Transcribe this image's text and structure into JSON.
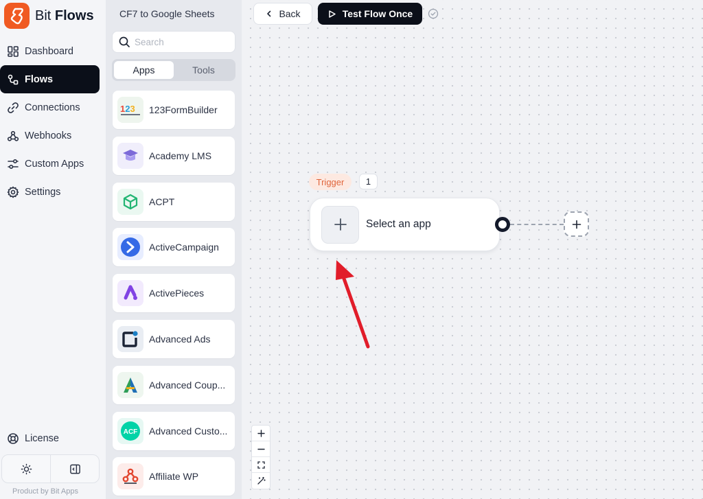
{
  "brand": {
    "name_light": "Bit",
    "name_bold": "Flows",
    "accent": "#f05a22"
  },
  "nav": {
    "items": [
      {
        "label": "Dashboard",
        "icon": "dashboard-icon"
      },
      {
        "label": "Flows",
        "icon": "flows-icon",
        "active": true
      },
      {
        "label": "Connections",
        "icon": "link-icon"
      },
      {
        "label": "Webhooks",
        "icon": "webhook-icon"
      },
      {
        "label": "Custom Apps",
        "icon": "sliders-icon"
      },
      {
        "label": "Settings",
        "icon": "gear-icon"
      }
    ],
    "license": "License",
    "footer": "Product by Bit Apps"
  },
  "panel": {
    "flow_name": "CF7 to Google Sheets",
    "search_placeholder": "Search",
    "tabs": [
      "Apps",
      "Tools"
    ],
    "active_tab": "Apps",
    "apps": [
      {
        "name": "123FormBuilder"
      },
      {
        "name": "Academy LMS"
      },
      {
        "name": "ACPT"
      },
      {
        "name": "ActiveCampaign"
      },
      {
        "name": "ActivePieces"
      },
      {
        "name": "Advanced Ads"
      },
      {
        "name": "Advanced Coup..."
      },
      {
        "name": "Advanced Custo..."
      },
      {
        "name": "Affiliate WP"
      }
    ]
  },
  "toolbar": {
    "back_label": "Back",
    "test_label": "Test Flow Once"
  },
  "canvas": {
    "trigger_label": "Trigger",
    "step_number": "1",
    "node_label": "Select an app"
  }
}
